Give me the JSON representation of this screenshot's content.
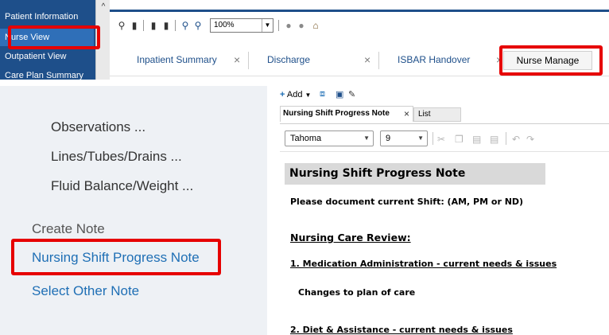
{
  "sidenav": {
    "items": [
      {
        "label": "Patient Information"
      },
      {
        "label": "Nurse View"
      },
      {
        "label": "Outpatient View"
      },
      {
        "label": "Care Plan Summary"
      }
    ]
  },
  "toolbar": {
    "zoom_value": "100%"
  },
  "tabs": [
    {
      "label": "Inpatient Summary"
    },
    {
      "label": "Discharge"
    },
    {
      "label": "ISBAR Handover"
    },
    {
      "label": "Nurse Manage"
    }
  ],
  "left_panel": {
    "items": [
      {
        "label": "Observations ..."
      },
      {
        "label": "Lines/Tubes/Drains ..."
      },
      {
        "label": "Fluid Balance/Weight ..."
      }
    ],
    "create_note_heading": "Create Note",
    "links": [
      {
        "label": "Nursing Shift Progress Note"
      },
      {
        "label": "Select Other Note"
      }
    ]
  },
  "editor": {
    "add_label": "Add",
    "note_tab_label": "Nursing Shift Progress Note",
    "list_tab_label": "List",
    "font_family": "Tahoma",
    "font_size": "9",
    "note": {
      "heading": "Nursing Shift Progress Note",
      "shift_prompt": "Please document current Shift: (AM, PM or ND)",
      "care_review_heading": "Nursing Care Review:",
      "item1": "1. Medication Administration - current needs & issues",
      "item1_sub": "Changes to plan of care",
      "item2": "2. Diet & Assistance - current needs & issues"
    }
  },
  "colors": {
    "nav_blue": "#1e4f8a",
    "highlight_red": "#e60000",
    "link_blue": "#1f6fb5"
  }
}
